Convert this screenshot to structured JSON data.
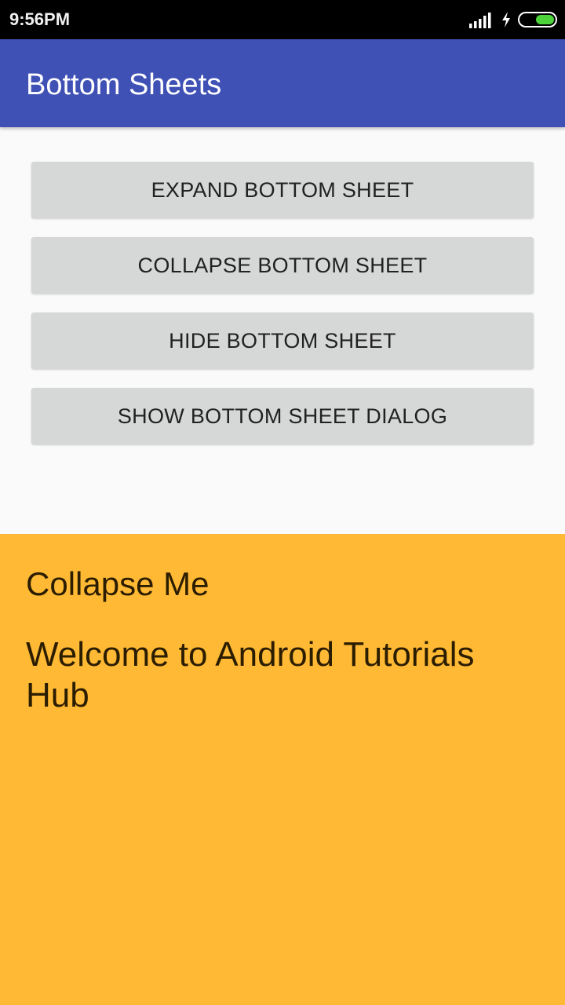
{
  "status_bar": {
    "time": "9:56PM",
    "battery_level": 0.55,
    "colors": {
      "battery": "#4cd43a"
    }
  },
  "app_bar": {
    "title": "Bottom Sheets",
    "color": "#3f51b5"
  },
  "buttons": {
    "expand_label": "EXPAND BOTTOM SHEET",
    "collapse_label": "COLLAPSE BOTTOM SHEET",
    "hide_label": "HIDE BOTTOM SHEET",
    "show_dialog_label": "SHOW BOTTOM SHEET DIALOG"
  },
  "bottom_sheet": {
    "heading": "Collapse Me",
    "text": "Welcome to Android Tutorials Hub",
    "color": "#ffb934"
  },
  "icons": [
    "signal-icon",
    "charging-icon",
    "battery-icon"
  ]
}
